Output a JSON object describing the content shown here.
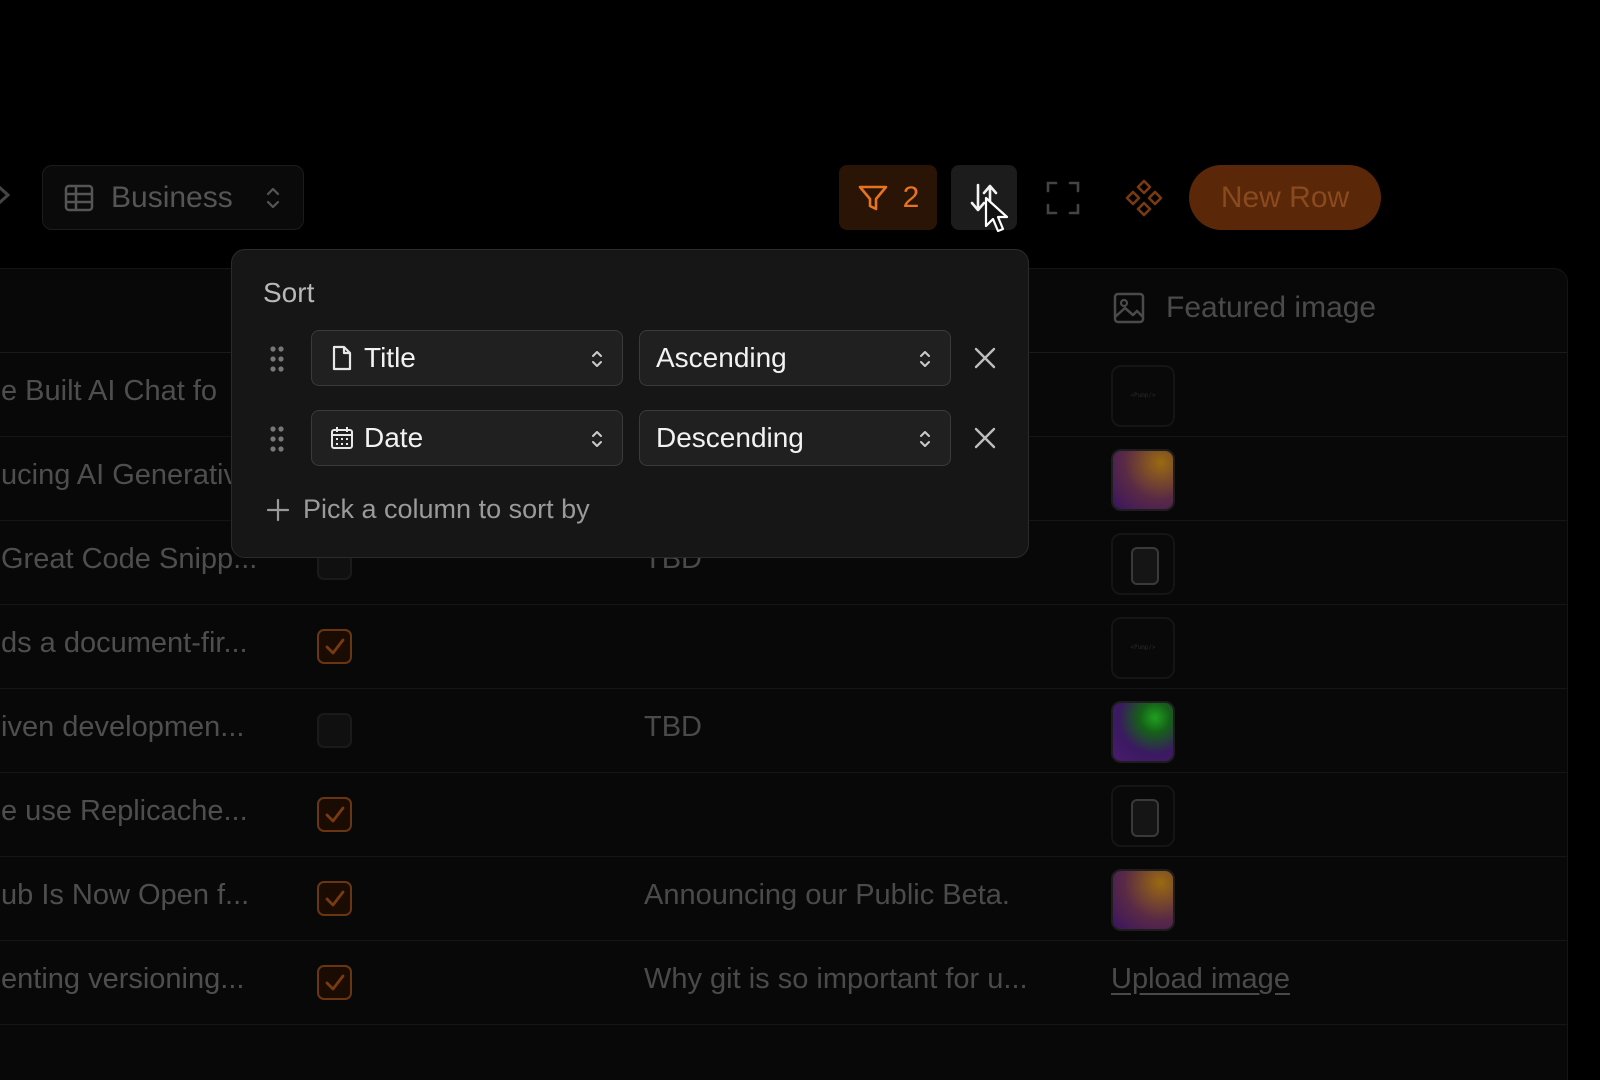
{
  "toolbar": {
    "table_name": "Business",
    "filter_count": "2",
    "new_row_label": "New Row"
  },
  "table": {
    "featured_column": "Featured image",
    "rows": [
      {
        "title": "e Built AI Chat fo",
        "checked": null,
        "desc": "",
        "image": "code"
      },
      {
        "title": "ucing AI Generativ",
        "checked": null,
        "desc": "",
        "image": "gradient-orange"
      },
      {
        "title": "Great Code Snipp...",
        "checked": false,
        "desc": "TBD",
        "image": "phone"
      },
      {
        "title": "ds a document-fir...",
        "checked": true,
        "desc": "",
        "image": "code"
      },
      {
        "title": "iven developmen...",
        "checked": false,
        "desc": "TBD",
        "image": "gradient-green"
      },
      {
        "title": "e use Replicache...",
        "checked": true,
        "desc": "",
        "image": "phone"
      },
      {
        "title": "ub Is Now Open f...",
        "checked": true,
        "desc": "Announcing our Public Beta.",
        "image": "gradient-orange"
      },
      {
        "title": "enting versioning...",
        "checked": true,
        "desc": "Why git is so important for u...",
        "image": "upload"
      }
    ],
    "upload_label": "Upload image",
    "thumb_code_text": "<Pump/>"
  },
  "sort_popover": {
    "title": "Sort",
    "rules": [
      {
        "column": "Title",
        "column_icon": "document-icon",
        "direction": "Ascending"
      },
      {
        "column": "Date",
        "column_icon": "calendar-icon",
        "direction": "Descending"
      }
    ],
    "add_label": "Pick a column to sort by"
  },
  "colors": {
    "accent": "#e8731f",
    "accent_bg": "#2a1405",
    "new_row_bg": "#5a2808"
  }
}
